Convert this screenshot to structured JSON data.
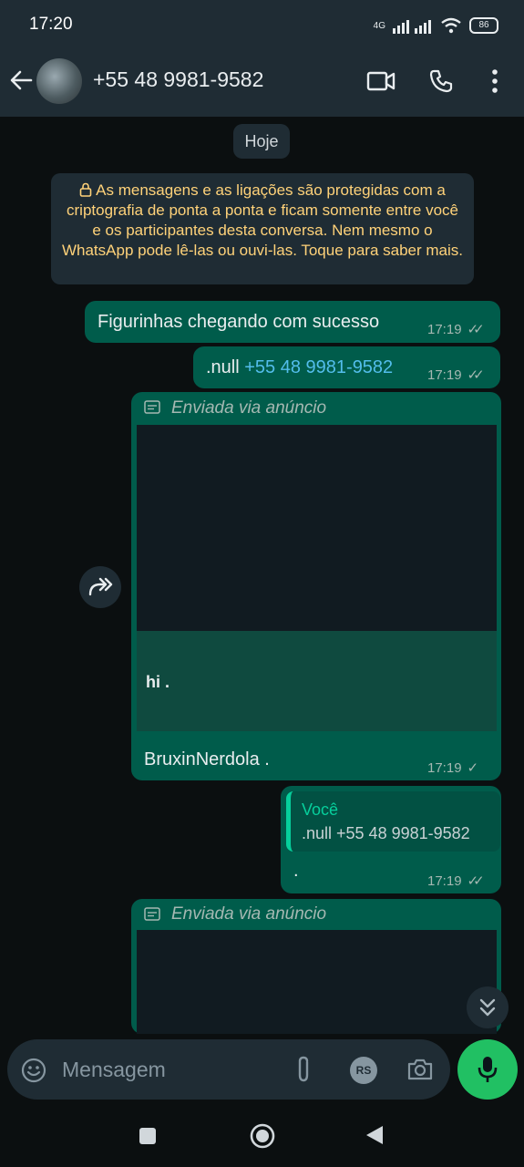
{
  "status_bar": {
    "time": "17:20",
    "network": "4G",
    "battery": "86"
  },
  "header": {
    "contact": "+55 48 9981-9582"
  },
  "chat": {
    "date_chip": "Hoje",
    "encryption_notice": "As mensagens e as ligações são protegidas com a criptografia de ponta a ponta e ficam somente entre você e os participantes desta conversa. Nem mesmo o WhatsApp pode lê-las ou ouvi-las. Toque para saber mais.",
    "messages": [
      {
        "text": "Figurinhas chegando com sucesso",
        "time": "17:19"
      },
      {
        "text": ".null ",
        "link": "+55 48 9981-9582",
        "time": "17:19"
      },
      {
        "ad_label": "Enviada via anúncio",
        "body": "hi .",
        "text": "BruxinNerdola .",
        "time": "17:19"
      },
      {
        "quote_author": "Você",
        "quote_text": ".null +55 48 9981-9582",
        "text": ".",
        "time": "17:19"
      },
      {
        "ad_label": "Enviada via anúncio"
      }
    ]
  },
  "composer": {
    "placeholder": "Mensagem",
    "sticker_badge": "RS"
  },
  "colors": {
    "header": "#1f2c34",
    "outgoing": "#005c4b",
    "accent": "#21c063",
    "link": "#53bdeb",
    "notice_text": "#ffd279"
  },
  "icons": [
    "back-arrow-icon",
    "video-call-icon",
    "phone-icon",
    "more-vert-icon",
    "lock-icon",
    "forward-icon",
    "ad-icon",
    "double-check-icon",
    "chevron-down-double-icon",
    "emoji-icon",
    "attach-icon",
    "camera-icon",
    "mic-icon",
    "nav-square-icon",
    "nav-home-icon",
    "nav-back-icon"
  ]
}
